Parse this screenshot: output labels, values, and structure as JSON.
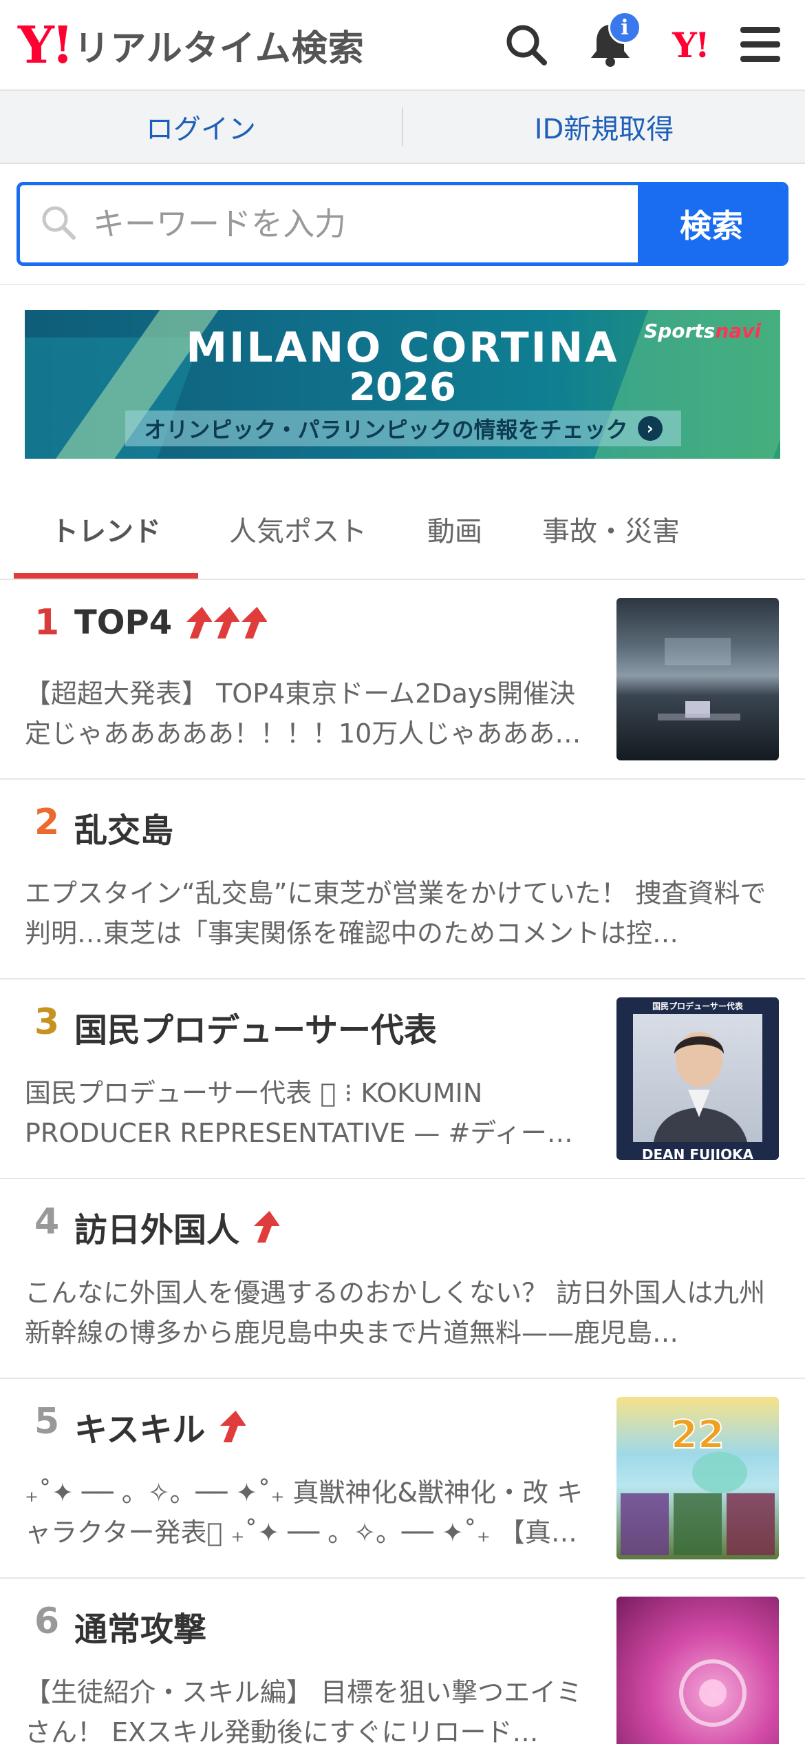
{
  "header": {
    "logo_mark": "Y!",
    "logo_text": "リアルタイム検索",
    "icons": [
      "search-icon",
      "bell-icon",
      "yahoo-japan-icon",
      "menu-icon"
    ],
    "notification_badge": "i",
    "yahoo_small": "Y!"
  },
  "login_bar": {
    "login": "ログイン",
    "register": "ID新規取得"
  },
  "search": {
    "placeholder": "キーワードを入力",
    "button": "検索"
  },
  "banner": {
    "line1": "MILANO CORTINA",
    "line2": "2026",
    "cta": "オリンピック・パラリンピックの情報をチェック",
    "brand_a": "Sports",
    "brand_b": "navi"
  },
  "tabs": [
    {
      "label": "トレンド",
      "active": true
    },
    {
      "label": "人気ポスト",
      "active": false
    },
    {
      "label": "動画",
      "active": false
    },
    {
      "label": "事故・災害",
      "active": false
    }
  ],
  "colors": {
    "accent": "#1a6cf0",
    "rank1": "#d93b3b",
    "rank2": "#ec6a2e",
    "rank3": "#c79320",
    "rank_other": "#999999",
    "trend_arrow": "#e03c3c"
  },
  "trends": [
    {
      "rank": "1",
      "title": "TOP4",
      "arrows": 3,
      "desc": "【超超大発表】 TOP4東京ドーム2Days開催決定じゃあああああ！！！！10万人じゃあああ…",
      "thumb": "concert"
    },
    {
      "rank": "2",
      "title": "乱交島",
      "arrows": 0,
      "desc": "エプスタイン“乱交島”に東芝が営業をかけていた！ 捜査資料で判明…東芝は「事実関係を確認中のためコメントは控…",
      "thumb": null
    },
    {
      "rank": "3",
      "title": "国民プロデューサー代表",
      "arrows": 0,
      "desc": "国民プロデューサー代表 􀠀 ⁝ KOKUMIN PRODUCER REPRESENTATIVE — #ディー…",
      "thumb": "portrait",
      "thumb_top": "国民プロデューサー代表",
      "thumb_bottom": "DEAN FUJIOKA"
    },
    {
      "rank": "4",
      "title": "訪日外国人",
      "arrows": 1,
      "desc": "こんなに外国人を優遇するのおかしくない？ 訪日外国人は九州新幹線の博多から鹿児島中央まで片道無料——鹿児島…",
      "thumb": null
    },
    {
      "rank": "5",
      "title": "キスキル",
      "arrows": 1,
      "desc": "₊˚✦ ── 。✧。── ✦˚₊ 真獣神化&獣神化・改 キャラクター発表􀠀 ₊˚✦ ── 。✧。── ✦˚₊ 【真…",
      "thumb": "game"
    },
    {
      "rank": "6",
      "title": "通常攻撃",
      "arrows": 0,
      "desc": "【生徒紹介・スキル編】 目標を狙い撃つエイミさん！ EXスキル発動後にすぐにリロード…",
      "thumb": "pink"
    }
  ]
}
